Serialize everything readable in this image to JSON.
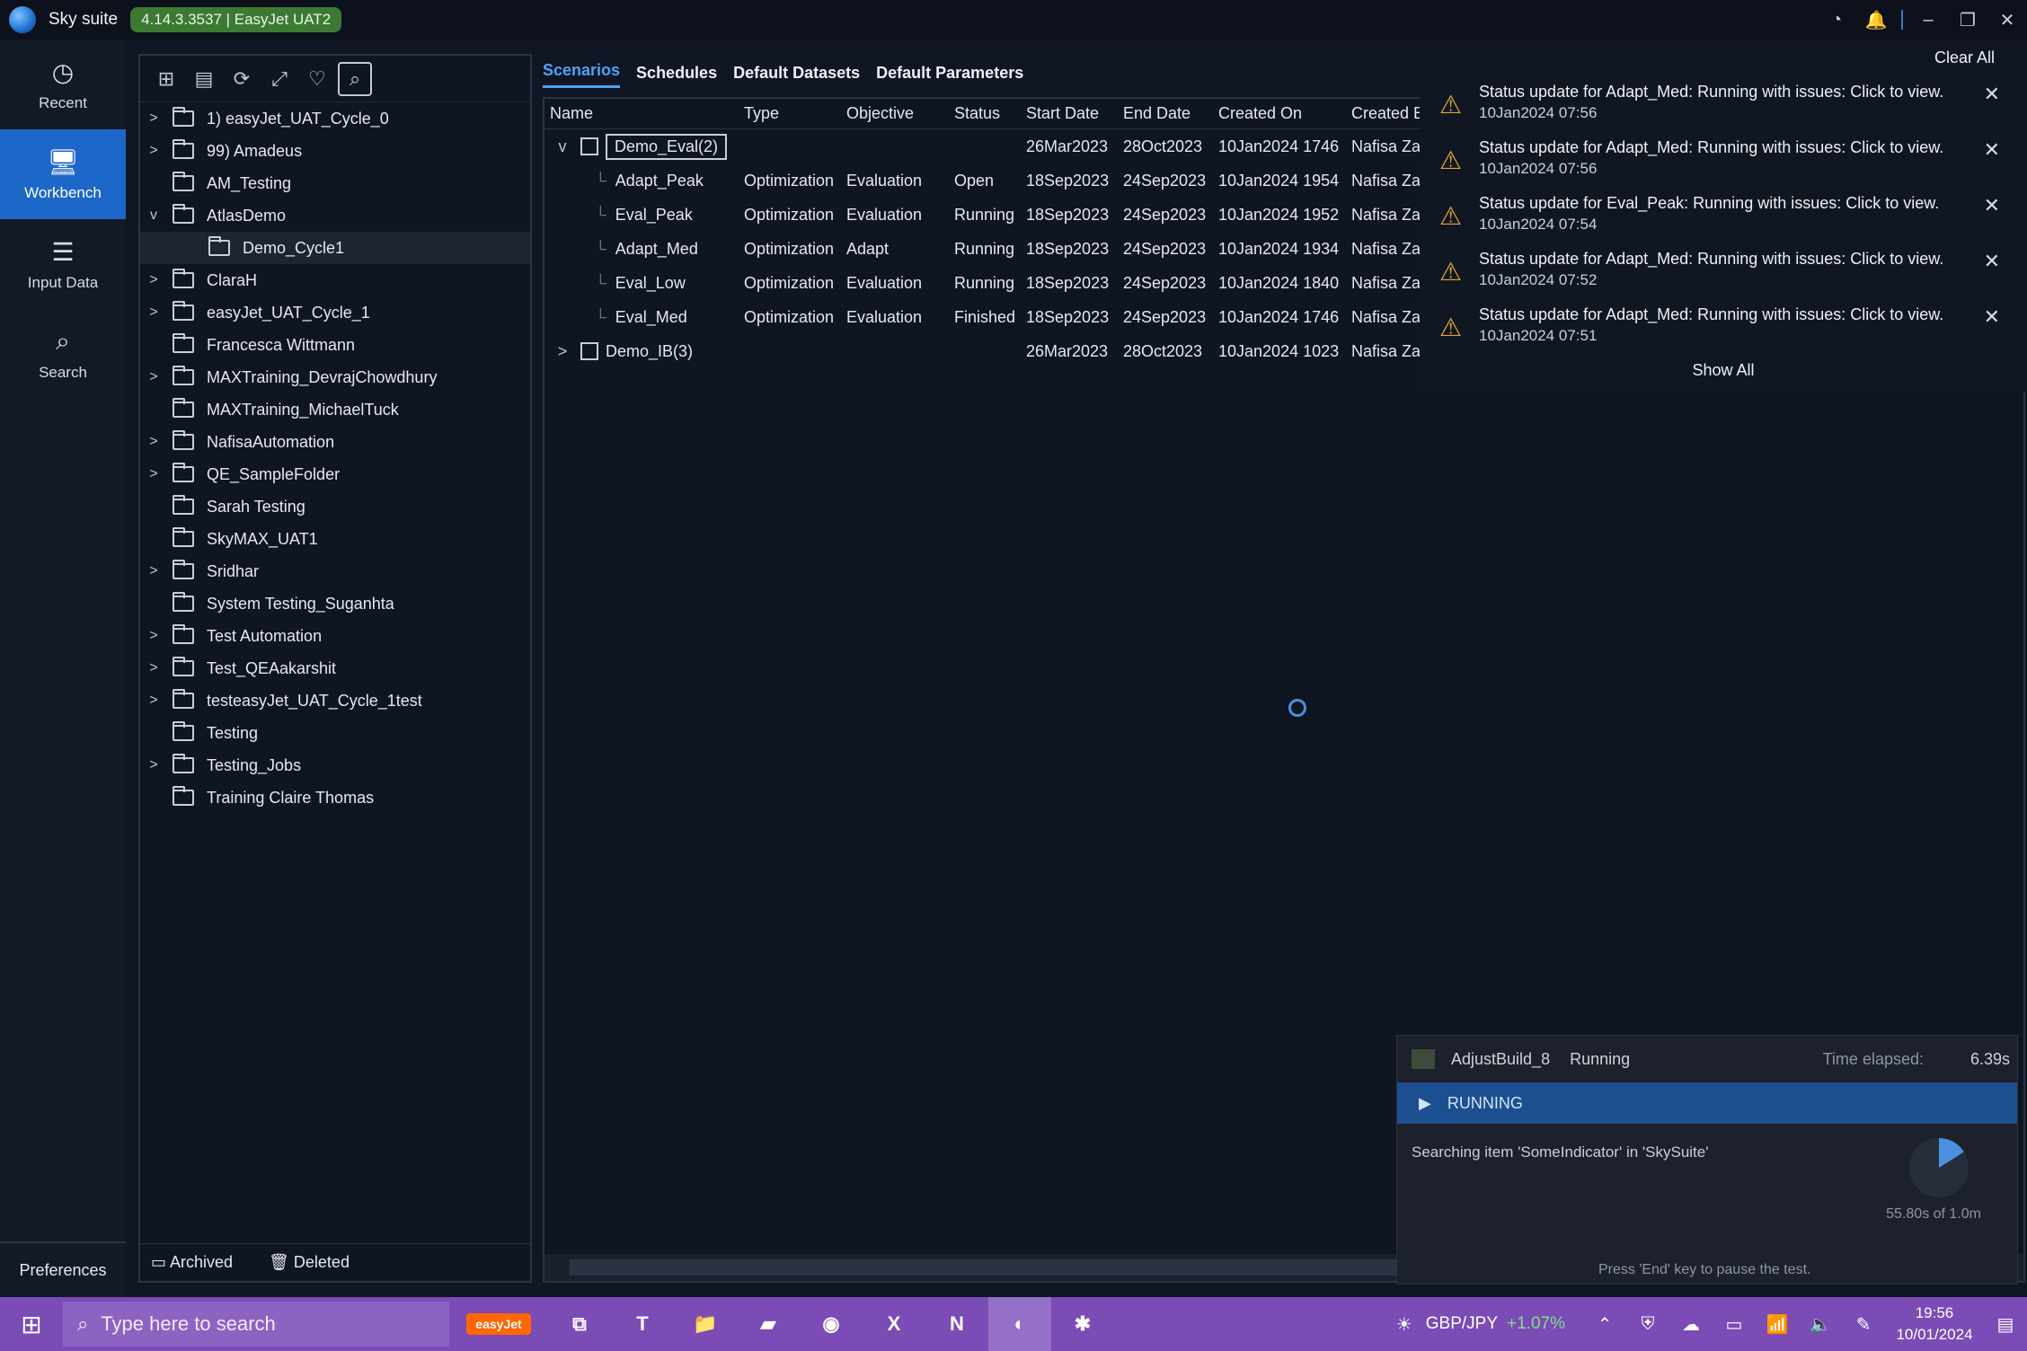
{
  "app": {
    "name": "Sky suite",
    "version": "4.14.3.3537 | EasyJet UAT2"
  },
  "nav": [
    {
      "label": "Recent",
      "icon": "clock-icon"
    },
    {
      "label": "Workbench",
      "icon": "monitor-icon"
    },
    {
      "label": "Input Data",
      "icon": "database-icon"
    },
    {
      "label": "Search",
      "icon": "search-icon"
    }
  ],
  "preferences": "Preferences",
  "tree": [
    {
      "label": "1) easyJet_UAT_Cycle_0",
      "chev": ">"
    },
    {
      "label": "99) Amadeus",
      "chev": ">"
    },
    {
      "label": "AM_Testing",
      "chev": ""
    },
    {
      "label": "AtlasDemo",
      "chev": "v"
    },
    {
      "label": "Demo_Cycle1",
      "chev": "",
      "child": true
    },
    {
      "label": "ClaraH",
      "chev": ">"
    },
    {
      "label": "easyJet_UAT_Cycle_1",
      "chev": ">"
    },
    {
      "label": "Francesca Wittmann",
      "chev": ""
    },
    {
      "label": "MAXTraining_DevrajChowdhury",
      "chev": ">"
    },
    {
      "label": "MAXTraining_MichaelTuck",
      "chev": ""
    },
    {
      "label": "NafisaAutomation",
      "chev": ">"
    },
    {
      "label": "QE_SampleFolder",
      "chev": ">"
    },
    {
      "label": "Sarah Testing",
      "chev": ""
    },
    {
      "label": "SkyMAX_UAT1",
      "chev": ""
    },
    {
      "label": "Sridhar",
      "chev": ">"
    },
    {
      "label": "System Testing_Suganhta",
      "chev": ""
    },
    {
      "label": "Test Automation",
      "chev": ">"
    },
    {
      "label": "Test_QEAakarshit",
      "chev": ">"
    },
    {
      "label": "testeasyJet_UAT_Cycle_1test",
      "chev": ">"
    },
    {
      "label": "Testing",
      "chev": ""
    },
    {
      "label": "Testing_Jobs",
      "chev": ">"
    },
    {
      "label": "Training Claire Thomas",
      "chev": ""
    }
  ],
  "tree_bottom": {
    "archived": "Archived",
    "deleted": "Deleted"
  },
  "tabs": [
    "Scenarios",
    "Schedules",
    "Default Datasets",
    "Default Parameters"
  ],
  "columns": [
    "Name",
    "Type",
    "Objective",
    "Status",
    "Start Date",
    "End Date",
    "Created On",
    "Created B"
  ],
  "rows": [
    {
      "name": "Demo_Eval(2)",
      "type": "",
      "objective": "",
      "status": "",
      "start": "26Mar2023",
      "end": "28Oct2023",
      "created": "10Jan2024 1746",
      "by": "Nafisa Zar",
      "group": true,
      "chev": "v"
    },
    {
      "name": "Adapt_Peak",
      "type": "Optimization",
      "objective": "Evaluation",
      "status": "Open",
      "start": "18Sep2023",
      "end": "24Sep2023",
      "created": "10Jan2024 1954",
      "by": "Nafisa Zar"
    },
    {
      "name": "Eval_Peak",
      "type": "Optimization",
      "objective": "Evaluation",
      "status": "Running",
      "start": "18Sep2023",
      "end": "24Sep2023",
      "created": "10Jan2024 1952",
      "by": "Nafisa Zar"
    },
    {
      "name": "Adapt_Med",
      "type": "Optimization",
      "objective": "Adapt",
      "status": "Running",
      "start": "18Sep2023",
      "end": "24Sep2023",
      "created": "10Jan2024 1934",
      "by": "Nafisa Zar"
    },
    {
      "name": "Eval_Low",
      "type": "Optimization",
      "objective": "Evaluation",
      "status": "Running",
      "start": "18Sep2023",
      "end": "24Sep2023",
      "created": "10Jan2024 1840",
      "by": "Nafisa Zar"
    },
    {
      "name": "Eval_Med",
      "type": "Optimization",
      "objective": "Evaluation",
      "status": "Finished",
      "start": "18Sep2023",
      "end": "24Sep2023",
      "created": "10Jan2024 1746",
      "by": "Nafisa Zar"
    },
    {
      "name": "Demo_IB(3)",
      "type": "",
      "objective": "",
      "status": "",
      "start": "26Mar2023",
      "end": "28Oct2023",
      "created": "10Jan2024 1023",
      "by": "Nafisa Zar",
      "group": true,
      "chev": ">"
    }
  ],
  "notifications": {
    "clear_all": "Clear All",
    "show_all": "Show All",
    "items": [
      {
        "text": "Status update for Adapt_Med: Running with issues: Click to view.",
        "time": "10Jan2024 07:56"
      },
      {
        "text": "Status update for Adapt_Med: Running with issues: Click to view.",
        "time": "10Jan2024 07:56"
      },
      {
        "text": "Status update for Eval_Peak: Running with issues: Click to view.",
        "time": "10Jan2024 07:54"
      },
      {
        "text": "Status update for Adapt_Med: Running with issues: Click to view.",
        "time": "10Jan2024 07:52"
      },
      {
        "text": "Status update for Adapt_Med: Running with issues: Click to view.",
        "time": "10Jan2024 07:51"
      }
    ]
  },
  "runner": {
    "job": "AdjustBuild_8",
    "state": "Running",
    "elapsed_label": "Time elapsed:",
    "elapsed": "6.39s",
    "banner": "RUNNING",
    "message": "Searching item 'SomeIndicator' in 'SkySuite'",
    "progress": 0.16,
    "timer": "55.80s of 1.0m",
    "footer": "Press 'End' key to pause the test."
  },
  "taskbar": {
    "search_placeholder": "Type here to search",
    "ticker": "GBP/JPY",
    "change": "+1.07%",
    "time": "19:56",
    "date": "10/01/2024"
  }
}
